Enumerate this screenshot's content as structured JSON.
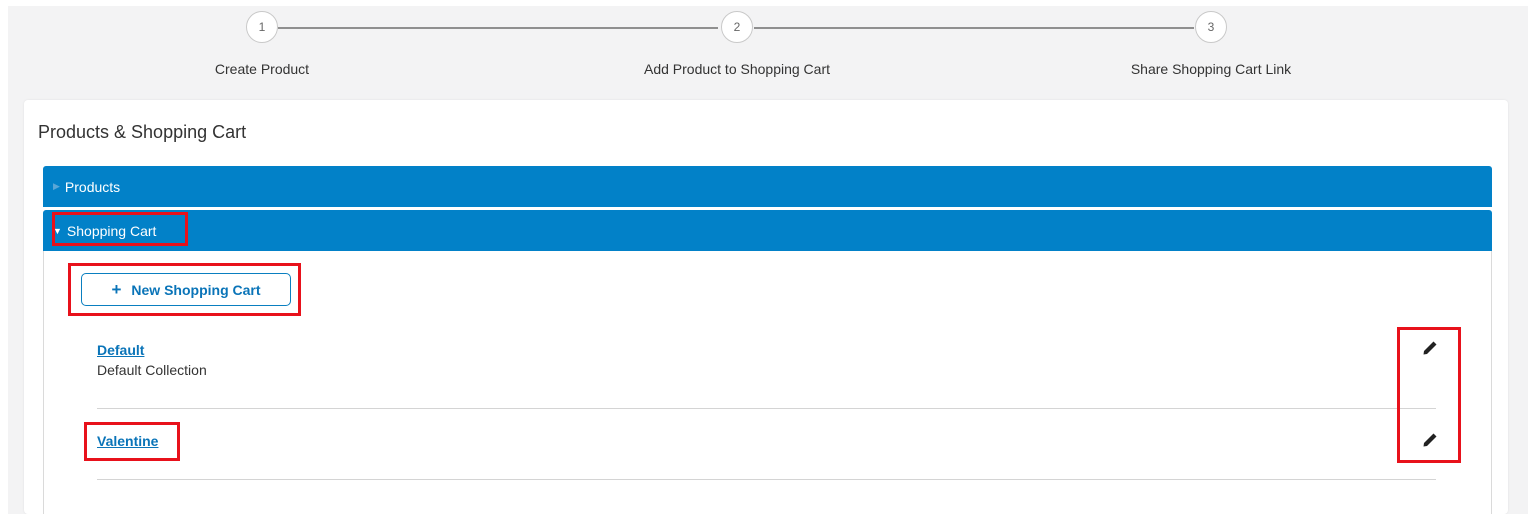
{
  "stepper": {
    "steps": [
      {
        "number": "1",
        "label": "Create Product"
      },
      {
        "number": "2",
        "label": "Add Product to Shopping Cart"
      },
      {
        "number": "3",
        "label": "Share Shopping Cart Link"
      }
    ]
  },
  "card": {
    "title": "Products & Shopping Cart"
  },
  "accordion": {
    "products_label": "Products",
    "shopping_cart_label": "Shopping Cart"
  },
  "shopping_cart": {
    "new_button_label": "New Shopping Cart",
    "carts": [
      {
        "name": "Default",
        "description": "Default Collection"
      },
      {
        "name": "Valentine",
        "description": ""
      }
    ]
  },
  "icons": {
    "edit": "pencil-icon",
    "expand": "caret-right-icon",
    "collapse": "caret-down-icon",
    "add": "plus-icon"
  },
  "colors": {
    "accent": "#0281c8",
    "link": "#0a74b8",
    "highlight": "#e8111b",
    "stepper_line": "#8f8f8f"
  }
}
